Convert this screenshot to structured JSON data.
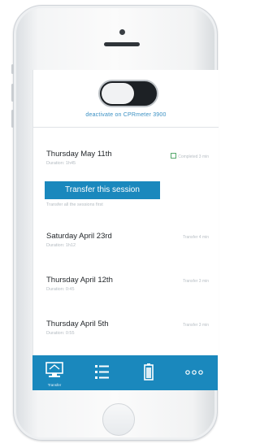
{
  "device": {
    "name_label": "deactivate on CPRmeter 3900",
    "toggle_state": "off"
  },
  "sessions": [
    {
      "date": "Thursday May 11th",
      "subtitle": "Duration: 1h45",
      "status": "Completed 3 min"
    },
    {
      "date": "Saturday April 23rd",
      "subtitle": "Duration: 1h12",
      "status": "Transfer 4 min"
    },
    {
      "date": "Thursday April 12th",
      "subtitle": "Duration: 0:45",
      "status": "Transfer 3 min"
    },
    {
      "date": "Thursday April 5th",
      "subtitle": "Duration: 0:55",
      "status": "Transfer 3 min"
    }
  ],
  "transfer": {
    "button_label": "Transfer this session",
    "note": "Transfer all the sessions first"
  },
  "tabbar": {
    "tabs": [
      {
        "label": "Transfer",
        "icon": "monitor-transfer-icon",
        "active": true
      },
      {
        "label": "",
        "icon": "list-icon",
        "active": false
      },
      {
        "label": "",
        "icon": "battery-icon",
        "active": false
      },
      {
        "label": "",
        "icon": "more-icon",
        "active": false
      }
    ]
  },
  "colors": {
    "accent": "#1a88bd",
    "text_dark": "#1f2327",
    "text_muted": "#b4bbc1",
    "device_link": "#3a90c3"
  }
}
